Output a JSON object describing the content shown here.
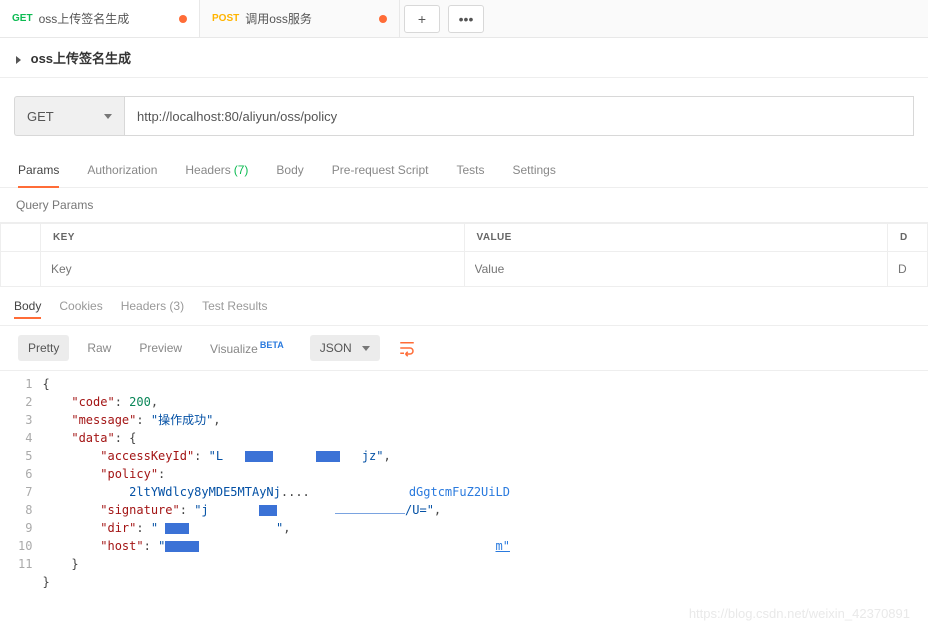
{
  "tabs": [
    {
      "method": "GET",
      "title": "oss上传签名生成",
      "dirty": true,
      "active": true
    },
    {
      "method": "POST",
      "title": "调用oss服务",
      "dirty": true,
      "active": false
    }
  ],
  "breadcrumb": {
    "title": "oss上传签名生成"
  },
  "request": {
    "method": "GET",
    "url": "http://localhost:80/aliyun/oss/policy",
    "tabs": {
      "params": "Params",
      "authorization": "Authorization",
      "headers": "Headers",
      "headers_count": "(7)",
      "body": "Body",
      "prerequest": "Pre-request Script",
      "tests": "Tests",
      "settings": "Settings"
    },
    "section_title": "Query Params",
    "kv": {
      "key_header": "KEY",
      "value_header": "VALUE",
      "desc_header": "D",
      "key_placeholder": "Key",
      "value_placeholder": "Value",
      "desc_placeholder": "D"
    }
  },
  "response": {
    "tabs": {
      "body": "Body",
      "cookies": "Cookies",
      "headers": "Headers",
      "headers_count": "(3)",
      "test_results": "Test Results"
    },
    "views": {
      "pretty": "Pretty",
      "raw": "Raw",
      "preview": "Preview",
      "visualize": "Visualize",
      "visualize_badge": "BETA"
    },
    "format": "JSON",
    "json": {
      "code_key": "\"code\"",
      "code_val": "200",
      "message_key": "\"message\"",
      "message_val": "\"操作成功\"",
      "data_key": "\"data\"",
      "accessKeyId_key": "\"accessKeyId\"",
      "accessKeyId_prefix": "\"L",
      "accessKeyId_suffix": "jz\"",
      "policy_key": "\"policy\"",
      "policy_frag1": "2ltYWdlcy8yMDE5MTAyNj",
      "policy_trail": "dGgtcmFuZ2UiLD",
      "signature_key": "\"signature\"",
      "signature_prefix": "\"j",
      "signature_suffix": "/U=\"",
      "dir_key": "\"dir\"",
      "dir_prefix": "\"",
      "dir_suffix": "\"",
      "host_key": "\"host\"",
      "host_prefix": "\"",
      "host_suffix": "m\""
    },
    "line_numbers": [
      "1",
      "2",
      "3",
      "4",
      "5",
      "6",
      "",
      "7",
      "8",
      "9",
      "10",
      "11"
    ]
  },
  "watermark": "https://blog.csdn.net/weixin_42370891"
}
